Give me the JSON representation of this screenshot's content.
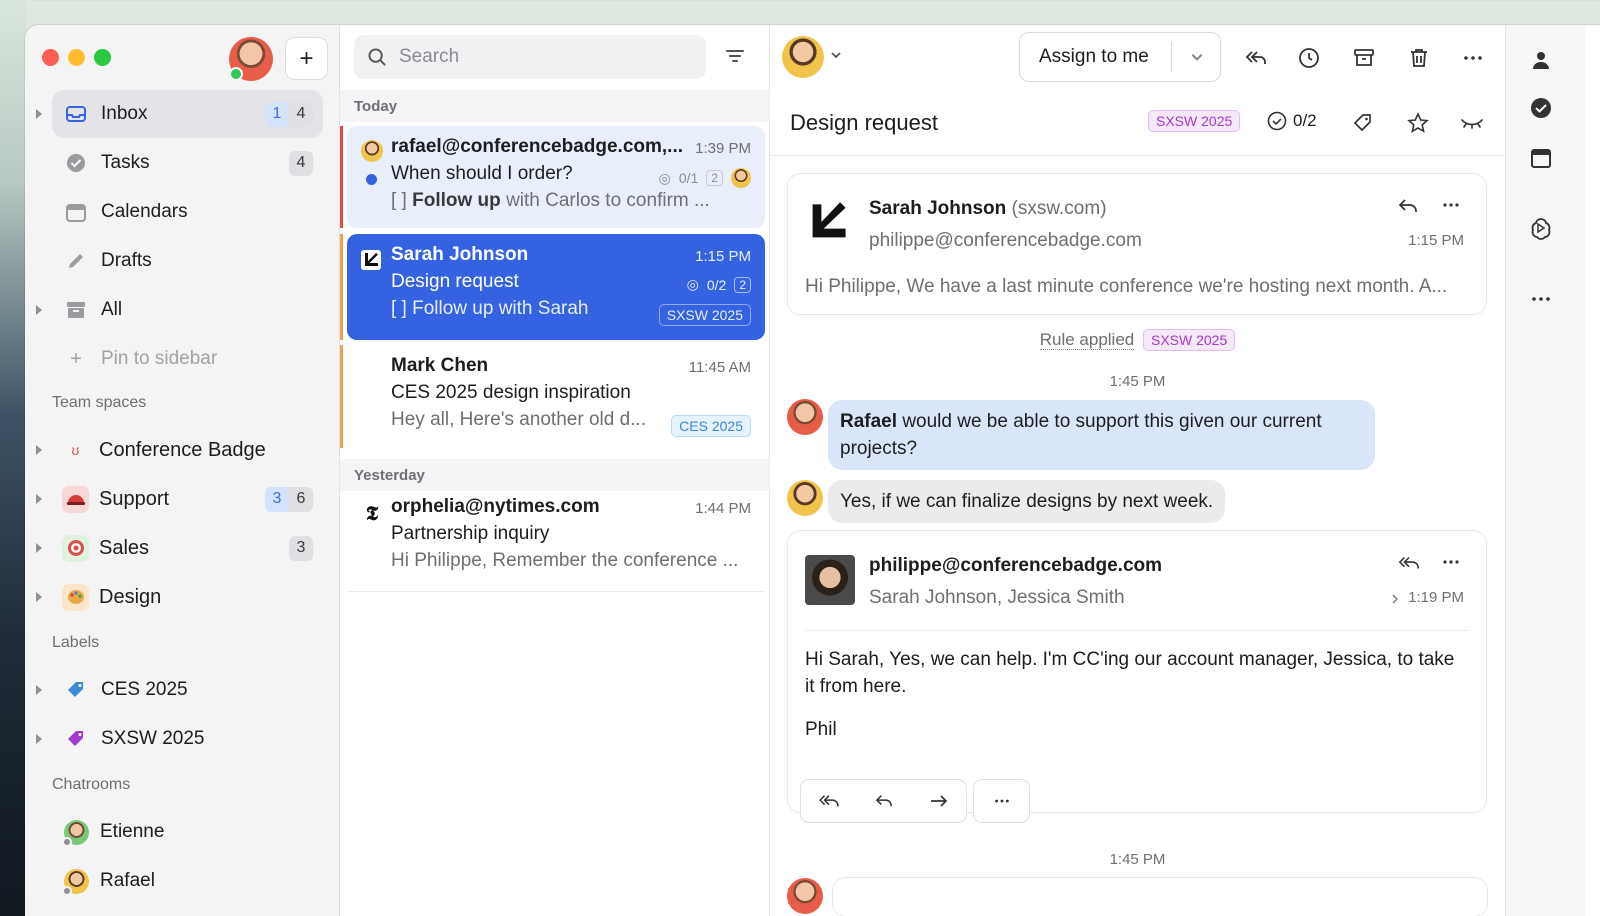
{
  "sidebar": {
    "nav": [
      {
        "label": "Inbox",
        "count_unread": "1",
        "count_total": "4"
      },
      {
        "label": "Tasks",
        "count": "4"
      },
      {
        "label": "Calendars"
      },
      {
        "label": "Drafts"
      },
      {
        "label": "All"
      },
      {
        "label": "Pin to sidebar"
      }
    ],
    "team_spaces_label": "Team spaces",
    "spaces": [
      {
        "label": "Conference Badge"
      },
      {
        "label": "Support",
        "count_unread": "3",
        "count_total": "6"
      },
      {
        "label": "Sales",
        "count": "3"
      },
      {
        "label": "Design"
      }
    ],
    "labels_label": "Labels",
    "labels": [
      {
        "label": "CES 2025",
        "color": "#3b8ad9"
      },
      {
        "label": "SXSW 2025",
        "color": "#a23bc9"
      }
    ],
    "chatrooms_label": "Chatrooms",
    "chatrooms": [
      {
        "label": "Etienne"
      },
      {
        "label": "Rafael"
      }
    ]
  },
  "list": {
    "search_placeholder": "Search",
    "today_label": "Today",
    "yesterday_label": "Yesterday",
    "mails": [
      {
        "sender": "rafael@conferencebadge.com,...",
        "time": "1:39 PM",
        "subject": "When should I order?",
        "task_count": "0/1",
        "thread_count": "2",
        "preview_bracket": "[ ]",
        "preview_bold": "Follow up",
        "preview_rest": "with Carlos to confirm ..."
      },
      {
        "sender": "Sarah Johnson",
        "time": "1:15 PM",
        "subject": "Design request",
        "task_count": "0/2",
        "thread_count": "2",
        "preview": "[ ] Follow up with Sarah",
        "tag": "SXSW 2025"
      },
      {
        "sender": "Mark Chen",
        "time": "11:45 AM",
        "subject": "CES 2025 design inspiration",
        "preview": "Hey all, Here's another old d...",
        "tag": "CES 2025"
      },
      {
        "sender": "orphelia@nytimes.com",
        "time": "1:44 PM",
        "subject": "Partnership inquiry",
        "preview": "Hi Philippe, Remember the conference ..."
      }
    ]
  },
  "reading": {
    "assign_label": "Assign to me",
    "subject": "Design request",
    "tag": "SXSW 2025",
    "task_count": "0/2",
    "first_message": {
      "sender": "Sarah Johnson",
      "domain": "(sxsw.com)",
      "to": "philippe@conferencebadge.com",
      "time": "1:15 PM",
      "body": "Hi Philippe, We have a last minute conference we're hosting next month. A..."
    },
    "rule_prefix": "Rule applied",
    "rule_tag": "SXSW 2025",
    "chat_time": "1:45 PM",
    "chat": [
      {
        "author": "Rafael",
        "text": "would we be able to support this given our current projects?"
      },
      {
        "text": "Yes, if we can finalize designs by next week."
      }
    ],
    "second_message": {
      "sender": "philippe@conferencebadge.com",
      "to": "Sarah Johnson, Jessica Smith",
      "time": "1:19 PM",
      "body": "Hi Sarah, Yes, we can help. I'm CC'ing our account manager, Jessica, to take it from here.",
      "signature": "Phil"
    },
    "bottom_time": "1:45 PM"
  }
}
